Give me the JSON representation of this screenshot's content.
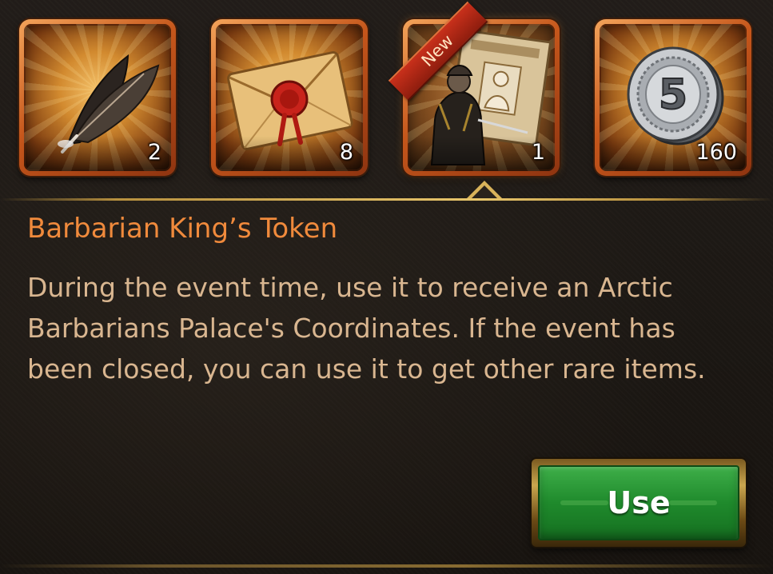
{
  "items": [
    {
      "icon": "feather-quill-icon",
      "quantity": "2"
    },
    {
      "icon": "sealed-envelope-icon",
      "quantity": "8"
    },
    {
      "icon": "barbarian-king-token-icon",
      "quantity": "1",
      "badge": "New",
      "selected": true
    },
    {
      "icon": "silver-coin-icon",
      "quantity": "160"
    }
  ],
  "detail": {
    "title": "Barbarian King’s Token",
    "description": "During the event time, use it to receive an Arctic Barbarians Palace's Coordinates. If the event has been closed, you can use it to get other rare items."
  },
  "actions": {
    "use_label": "Use"
  },
  "colors": {
    "title": "#f08a3c",
    "description": "#d9b690",
    "button_green": "#1f8a2c",
    "slot_frame": "#c5561b",
    "divider_gold": "#d9b35a"
  }
}
